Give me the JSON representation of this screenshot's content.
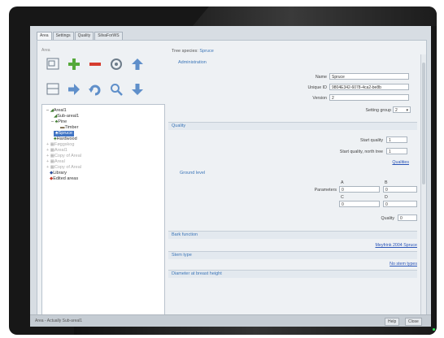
{
  "tabs": [
    {
      "label": "Area"
    },
    {
      "label": "Settings"
    },
    {
      "label": "Quality"
    },
    {
      "label": "SilvaForWS"
    }
  ],
  "toolbox": {
    "label": "Area",
    "icons": [
      "new-area-icon",
      "add-icon",
      "remove-icon",
      "refresh-icon",
      "up-arrow-icon",
      "grid-icon",
      "right-arrow-icon",
      "undo-icon",
      "search-icon",
      "down-arrow-icon"
    ]
  },
  "tree": [
    {
      "label": "Areal1"
    },
    {
      "label": "Sub-areal1"
    },
    {
      "label": "Pine"
    },
    {
      "label": "Timber"
    },
    {
      "label": "Spruce"
    },
    {
      "label": "Hardwood"
    },
    {
      "label": "Føggskog"
    },
    {
      "label": "Areal1"
    },
    {
      "label": "Copy of Areal"
    },
    {
      "label": "Areal"
    },
    {
      "label": "Copy of Areal"
    },
    {
      "label": "Library"
    },
    {
      "label": "Edited areas"
    }
  ],
  "header": {
    "type_label": "Tree species:",
    "type_value": "Spruce"
  },
  "administration": {
    "heading": "Administration",
    "name_label": "Name",
    "name_value": "Spruce",
    "uid_label": "Unique ID",
    "uid_value": "9804E342-6078-4ca2-be8b",
    "version_label": "Version",
    "version_value": "2",
    "setting_group_label": "Setting group",
    "setting_group_value": "2"
  },
  "quality": {
    "heading": "Quality",
    "start_quality_label": "Start quality",
    "start_quality_value": "1",
    "start_quality_mid_label": "Start quality, north tree",
    "start_quality_mid_value": "1",
    "link": "Qualities"
  },
  "ground_level": {
    "heading": "Ground level",
    "col_a": "A",
    "col_b": "B",
    "col_c": "C",
    "col_d": "D",
    "params_label": "Parameters",
    "a_value": "0",
    "b_value": "0",
    "c_value": "0",
    "d_value": "0",
    "quality_label": "Quality",
    "quality_value": "0"
  },
  "bark_function": {
    "heading": "Bark function",
    "link": "Meyfrink 2004 Spruce"
  },
  "stem_type": {
    "heading": "Stem type",
    "link": "No stem types"
  },
  "diameter": {
    "heading": "Diameter at breast height"
  },
  "status": {
    "text": "Area - Actually Sub-areal1",
    "help_label": "Help",
    "close_label": "Close"
  }
}
